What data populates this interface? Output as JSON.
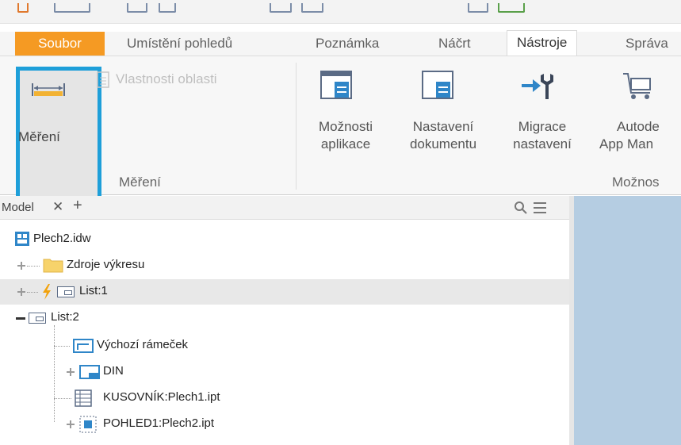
{
  "ribbon": {
    "tabs": [
      {
        "label": "Soubor"
      },
      {
        "label": "Umístění pohledů"
      },
      {
        "label": "Poznámka"
      },
      {
        "label": "Náčrt"
      },
      {
        "label": "Nástroje"
      },
      {
        "label": "Správa"
      }
    ],
    "measure_panel": {
      "measure_label": "Měření",
      "region_props_label": "Vlastnosti oblasti",
      "panel_title": "Měření"
    },
    "options_panel": {
      "app_options_l1": "Možnosti",
      "app_options_l2": "aplikace",
      "doc_settings_l1": "Nastavení",
      "doc_settings_l2": "dokumentu",
      "migrate_l1": "Migrace",
      "migrate_l2": "nastavení",
      "appstore_l1": "Autode",
      "appstore_l2": "App Man",
      "panel_title": "Možnos"
    }
  },
  "browser": {
    "tab_label": "Model",
    "close_glyph": "✕",
    "add_glyph": "+",
    "search_glyph": "⚲",
    "menu_glyph": "≡",
    "items": [
      {
        "label": "Plech2.idw"
      },
      {
        "label": "Zdroje výkresu"
      },
      {
        "label": "List:1"
      },
      {
        "label": "List:2"
      },
      {
        "label": "Výchozí rámeček"
      },
      {
        "label": "DIN"
      },
      {
        "label": "KUSOVNÍK:Plech1.ipt"
      },
      {
        "label": "POHLED1:Plech2.ipt"
      }
    ]
  },
  "colors": {
    "file_tab": "#f59a23",
    "highlight_border": "#1e9fd9",
    "graphics_bg": "#b5cde2"
  }
}
